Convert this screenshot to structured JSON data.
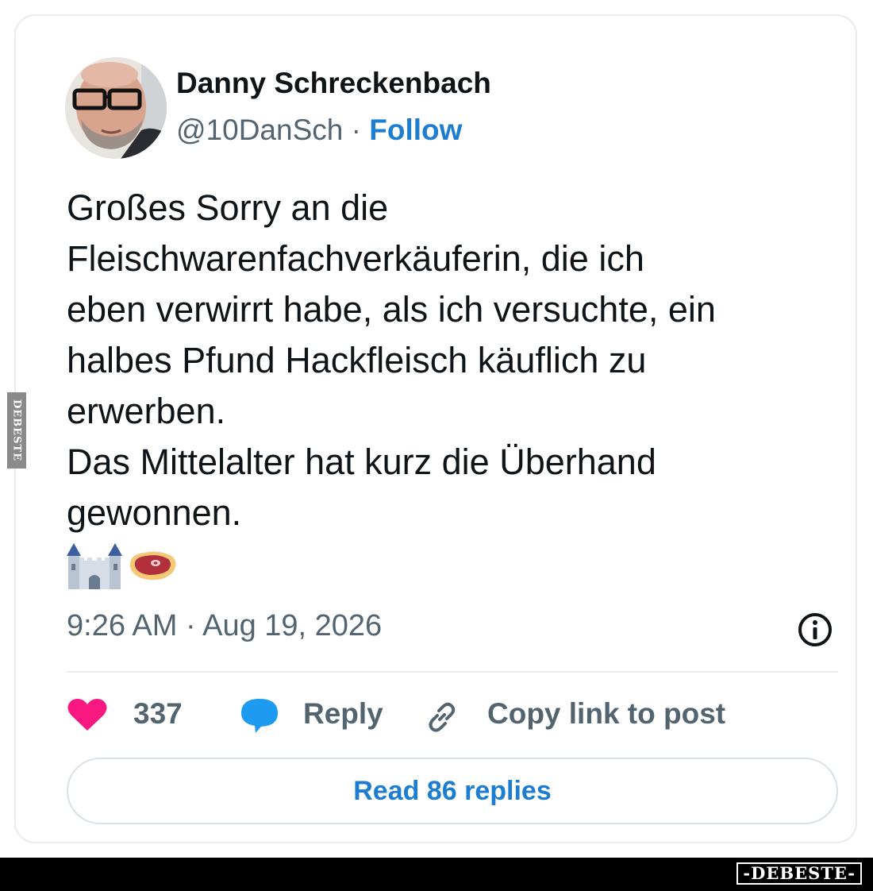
{
  "post": {
    "author": {
      "name": "Danny Schreckenbach",
      "handle": "@10DanSch",
      "separator": "·",
      "follow_label": "Follow"
    },
    "text_lines": [
      "Großes Sorry an die",
      "Fleischwarenfachverkäuferin, die ich",
      "eben verwirrt habe, als ich versuchte, ein",
      "halbes Pfund Hackfleisch käuflich zu",
      "erwerben.",
      "Das Mittelalter hat kurz die Überhand",
      "gewonnen."
    ],
    "emojis": [
      "castle-icon",
      "meat-steak-icon"
    ],
    "timestamp": "9:26 AM · Aug 19, 2026",
    "actions": {
      "like_count": "337",
      "reply_label": "Reply",
      "copy_link_label": "Copy link to post"
    },
    "read_replies_label": "Read 86 replies"
  },
  "watermark": {
    "side_text": "DEBESTE",
    "footer_text": "-DEBESTE-"
  },
  "colors": {
    "follow_blue": "#1d7dd0",
    "like_pink": "#f91880",
    "reply_blue": "#1d9bf0",
    "text_dark": "#0f1419",
    "text_gray": "#536471",
    "border": "#e6ecf0"
  }
}
